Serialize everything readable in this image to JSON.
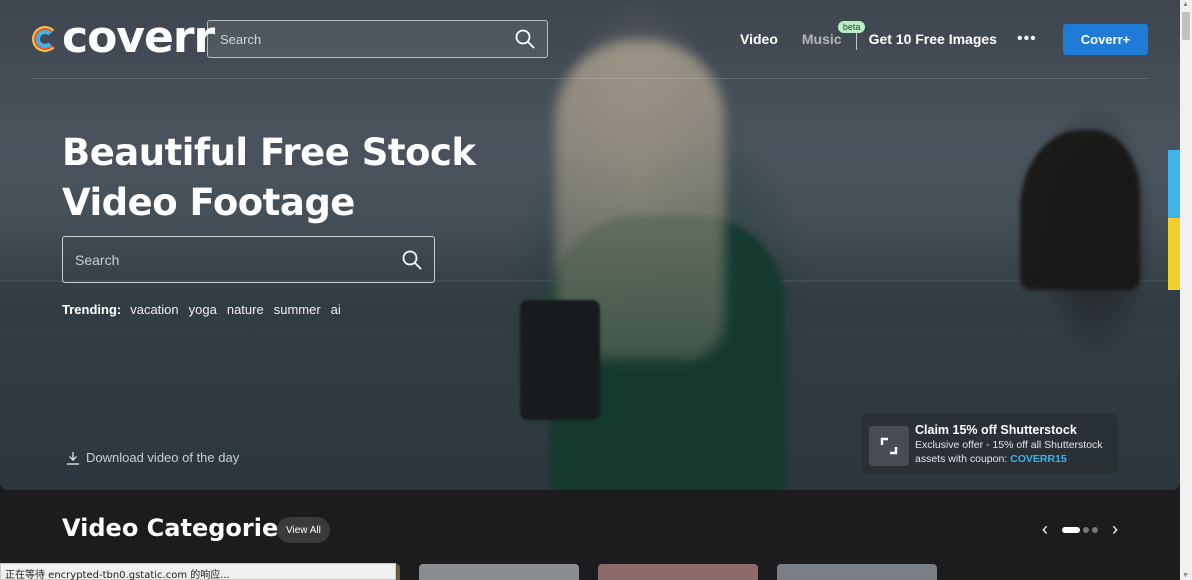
{
  "header": {
    "logo_text": "coverr",
    "search_placeholder": "Search",
    "nav": [
      {
        "label": "Video"
      },
      {
        "label": "Music",
        "badge": "beta"
      },
      {
        "label": "Get 10 Free Images"
      }
    ],
    "more_label": "•••",
    "cta_label": "Coverr+"
  },
  "hero": {
    "headline": "Beautiful Free Stock Video Footage",
    "search_placeholder": "Search",
    "trending_label": "Trending:",
    "trending_tags": [
      "vacation",
      "yoga",
      "nature",
      "summer",
      "ai"
    ],
    "download_label": "Download video of the day"
  },
  "promo": {
    "title": "Claim 15% off Shutterstock",
    "text": "Exclusive offer - 15% off all Shutterstock assets with coupon:",
    "coupon": "COVERR15"
  },
  "categories": {
    "title": "Video Categories",
    "view_all_label": "View All",
    "prev_icon": "chevron-left-icon",
    "next_icon": "chevron-right-icon",
    "pager": {
      "total": 3,
      "active": 1
    },
    "thumb_colors": [
      "#6b5a3a",
      "#8a8d91",
      "#8c6b6b",
      "#7a7f85"
    ]
  },
  "statusbar": {
    "text": "正在等待 encrypted-tbn0.gstatic.com 的响应..."
  },
  "colors": {
    "cta": "#1f7bd6",
    "coupon": "#3bb5e8",
    "beta_badge": "#b7f0c4",
    "accent_blue": "#3fb4ea",
    "accent_yellow": "#f5cf2e"
  }
}
